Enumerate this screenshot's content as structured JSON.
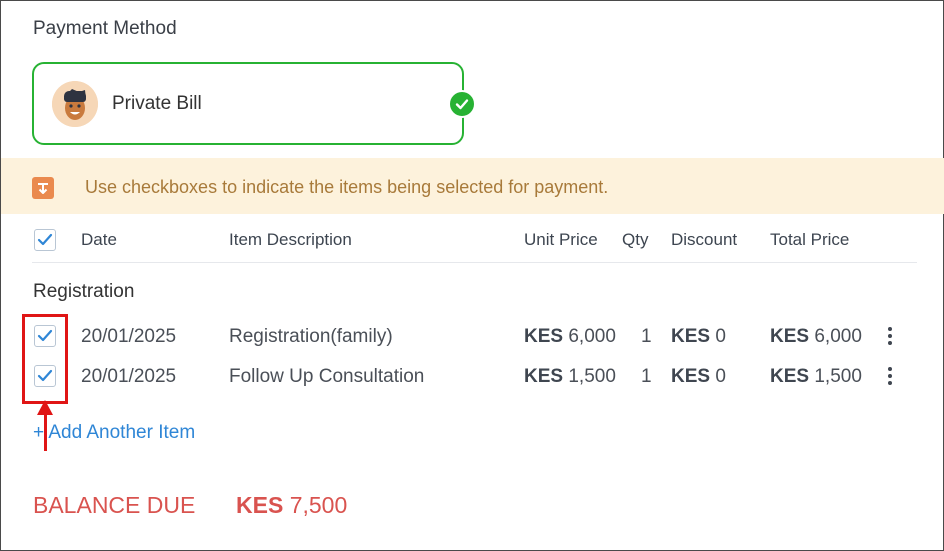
{
  "payment": {
    "section_title": "Payment Method",
    "method_label": "Private Bill",
    "selected": true
  },
  "notice": {
    "text": "Use checkboxes to indicate the items being selected for payment."
  },
  "table": {
    "headers": {
      "date": "Date",
      "description": "Item Description",
      "unit_price": "Unit Price",
      "qty": "Qty",
      "discount": "Discount",
      "total_price": "Total Price"
    },
    "select_all_checked": true,
    "group_label": "Registration",
    "rows": [
      {
        "checked": true,
        "date": "20/01/2025",
        "description": "Registration(family)",
        "unit_currency": "KES",
        "unit_amount": "6,000",
        "qty": "1",
        "discount_currency": "KES",
        "discount_amount": "0",
        "total_currency": "KES",
        "total_amount": "6,000"
      },
      {
        "checked": true,
        "date": "20/01/2025",
        "description": "Follow Up Consultation",
        "unit_currency": "KES",
        "unit_amount": "1,500",
        "qty": "1",
        "discount_currency": "KES",
        "discount_amount": "0",
        "total_currency": "KES",
        "total_amount": "1,500"
      }
    ],
    "add_item_label": "+ Add Another Item"
  },
  "balance": {
    "label": "BALANCE DUE",
    "currency": "KES",
    "amount": "7,500"
  },
  "colors": {
    "accent_green": "#27b233",
    "link_blue": "#2f86d6",
    "balance_red": "#d9534f",
    "annotation_red": "#e01515",
    "notice_bg": "#fdf2dc"
  },
  "icons": [
    "avatar-icon",
    "check-circle-icon",
    "info-arrow-icon",
    "checkbox-check-icon",
    "kebab-menu-icon",
    "annotation-arrow-icon"
  ]
}
